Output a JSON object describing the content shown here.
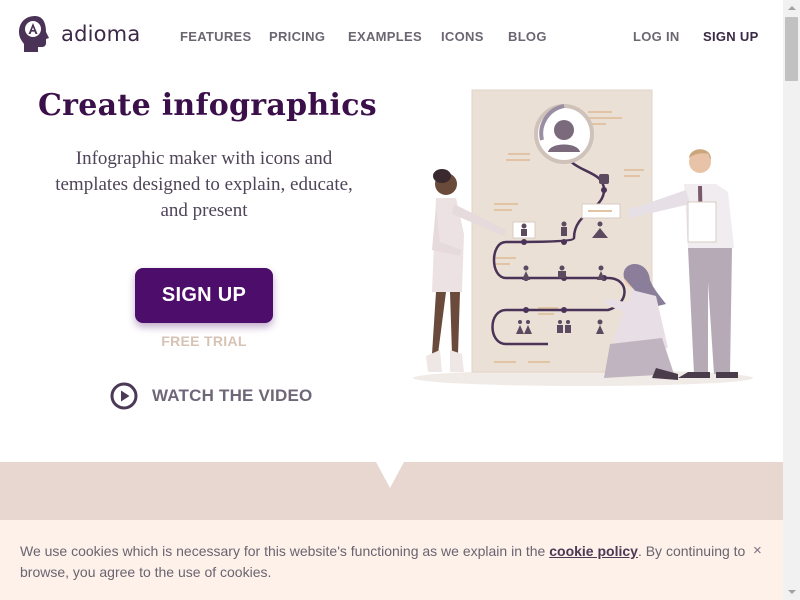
{
  "header": {
    "brand": "adioma",
    "logo_icon": "head-profile-logo-icon",
    "nav": [
      "FEATURES",
      "PRICING",
      "EXAMPLES",
      "ICONS",
      "BLOG"
    ],
    "login": "LOG IN",
    "signup": "SIGN UP"
  },
  "hero": {
    "title": "Create infographics",
    "subtitle": "Infographic maker with icons and templates designed to explain, educate, and present",
    "cta": "SIGN UP",
    "cta_note": "FREE TRIAL",
    "video_label": "WATCH THE VIDEO",
    "video_icon": "play-circle-icon"
  },
  "cookie": {
    "text_before": "We use cookies which is necessary for this website's functioning as we explain in the ",
    "link": "cookie policy",
    "text_after": ". By continuing to browse, you agree to the use of cookies.",
    "close": "×"
  },
  "colors": {
    "brand_purple": "#4d0d6a",
    "title_purple": "#3b0f4a",
    "band": "#e7d7d0",
    "cookie_bg": "#fdf1ea",
    "free_trial": "#d7c3b4"
  }
}
